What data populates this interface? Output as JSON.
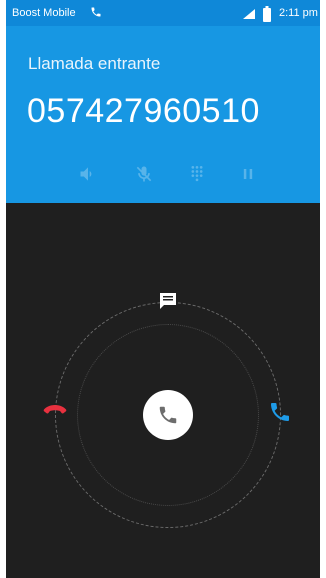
{
  "status_bar": {
    "carrier": "Boost Mobile",
    "time": "2:11 pm",
    "icons": [
      "phone-icon",
      "signal-icon",
      "battery-icon"
    ]
  },
  "call": {
    "status": "Llamada entrante",
    "number": "057427960510"
  },
  "controls": [
    "speaker-icon",
    "mute-icon",
    "dialpad-icon",
    "pause-icon"
  ],
  "actions": [
    "message-icon",
    "decline-call-icon",
    "answer-call-icon",
    "accept-call-icon"
  ],
  "colors": {
    "header_blue": "#1797e3",
    "statusbar_blue": "#0f88d8",
    "background": "#1f1f1f",
    "decline_red": "#e8313f",
    "accept_blue": "#1e9be8"
  }
}
